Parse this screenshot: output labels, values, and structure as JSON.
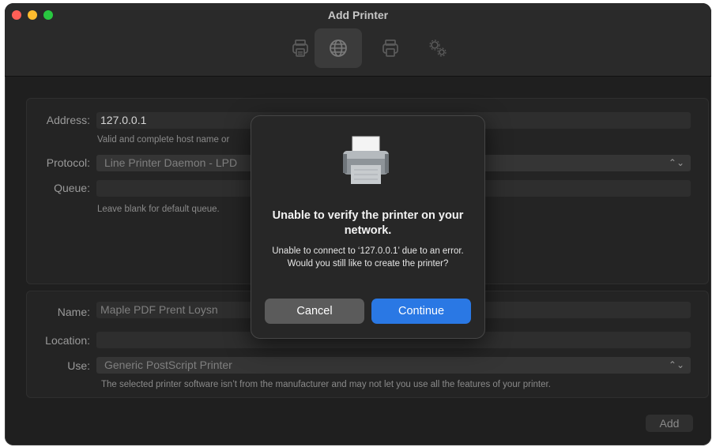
{
  "window": {
    "title": "Add Printer"
  },
  "toolbar": {
    "icons": [
      "printer-icon",
      "globe-icon",
      "windows-printer-icon",
      "gears-icon"
    ],
    "selected": "globe-icon"
  },
  "connection": {
    "address_label": "Address:",
    "address_value": "127.0.0.1",
    "address_hint": "Valid and complete host name or",
    "protocol_label": "Protocol:",
    "protocol_value": "Line Printer Daemon - LPD",
    "queue_label": "Queue:",
    "queue_value": "",
    "queue_hint": "Leave blank for default queue."
  },
  "details": {
    "name_label": "Name:",
    "name_value": "Maple PDF Prent Loysn",
    "location_label": "Location:",
    "location_value": "",
    "use_label": "Use:",
    "use_value": "Generic PostScript Printer",
    "use_hint": "The selected printer software isn’t from the manufacturer and may not let you use all the features of your printer."
  },
  "add_label": "Add",
  "dialog": {
    "icon": "printer-icon",
    "title": "Unable to verify the printer on your network.",
    "message": "Unable to connect to ‘127.0.0.1’ due to an error. Would you still like to create the printer?",
    "cancel_label": "Cancel",
    "continue_label": "Continue"
  },
  "colors": {
    "accent": "#2a78e4",
    "window_bg": "#1f1f1f"
  }
}
